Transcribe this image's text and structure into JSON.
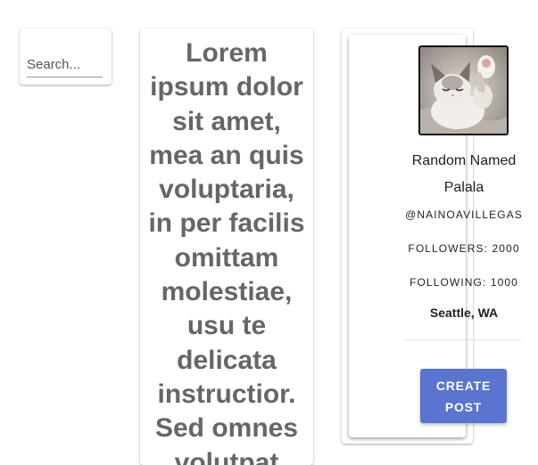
{
  "search": {
    "placeholder": "Search..."
  },
  "post": {
    "text": "Lorem ipsum dolor sit amet, mea an quis voluptaria, in per facilis omittam molestiae, usu te delicata instructior. Sed omnes volutpat"
  },
  "profile": {
    "avatar_icon": "cat-photo",
    "display_name": "Random Named Palala",
    "handle": "@NAINOAVILLEGAS",
    "followers": "FOLLOWERS: 2000",
    "following": "FOLLOWING: 1000",
    "location": "Seattle, WA",
    "create_post_label": "CREATE POST"
  },
  "colors": {
    "button": "#5a74cf",
    "post_text": "#666666"
  }
}
